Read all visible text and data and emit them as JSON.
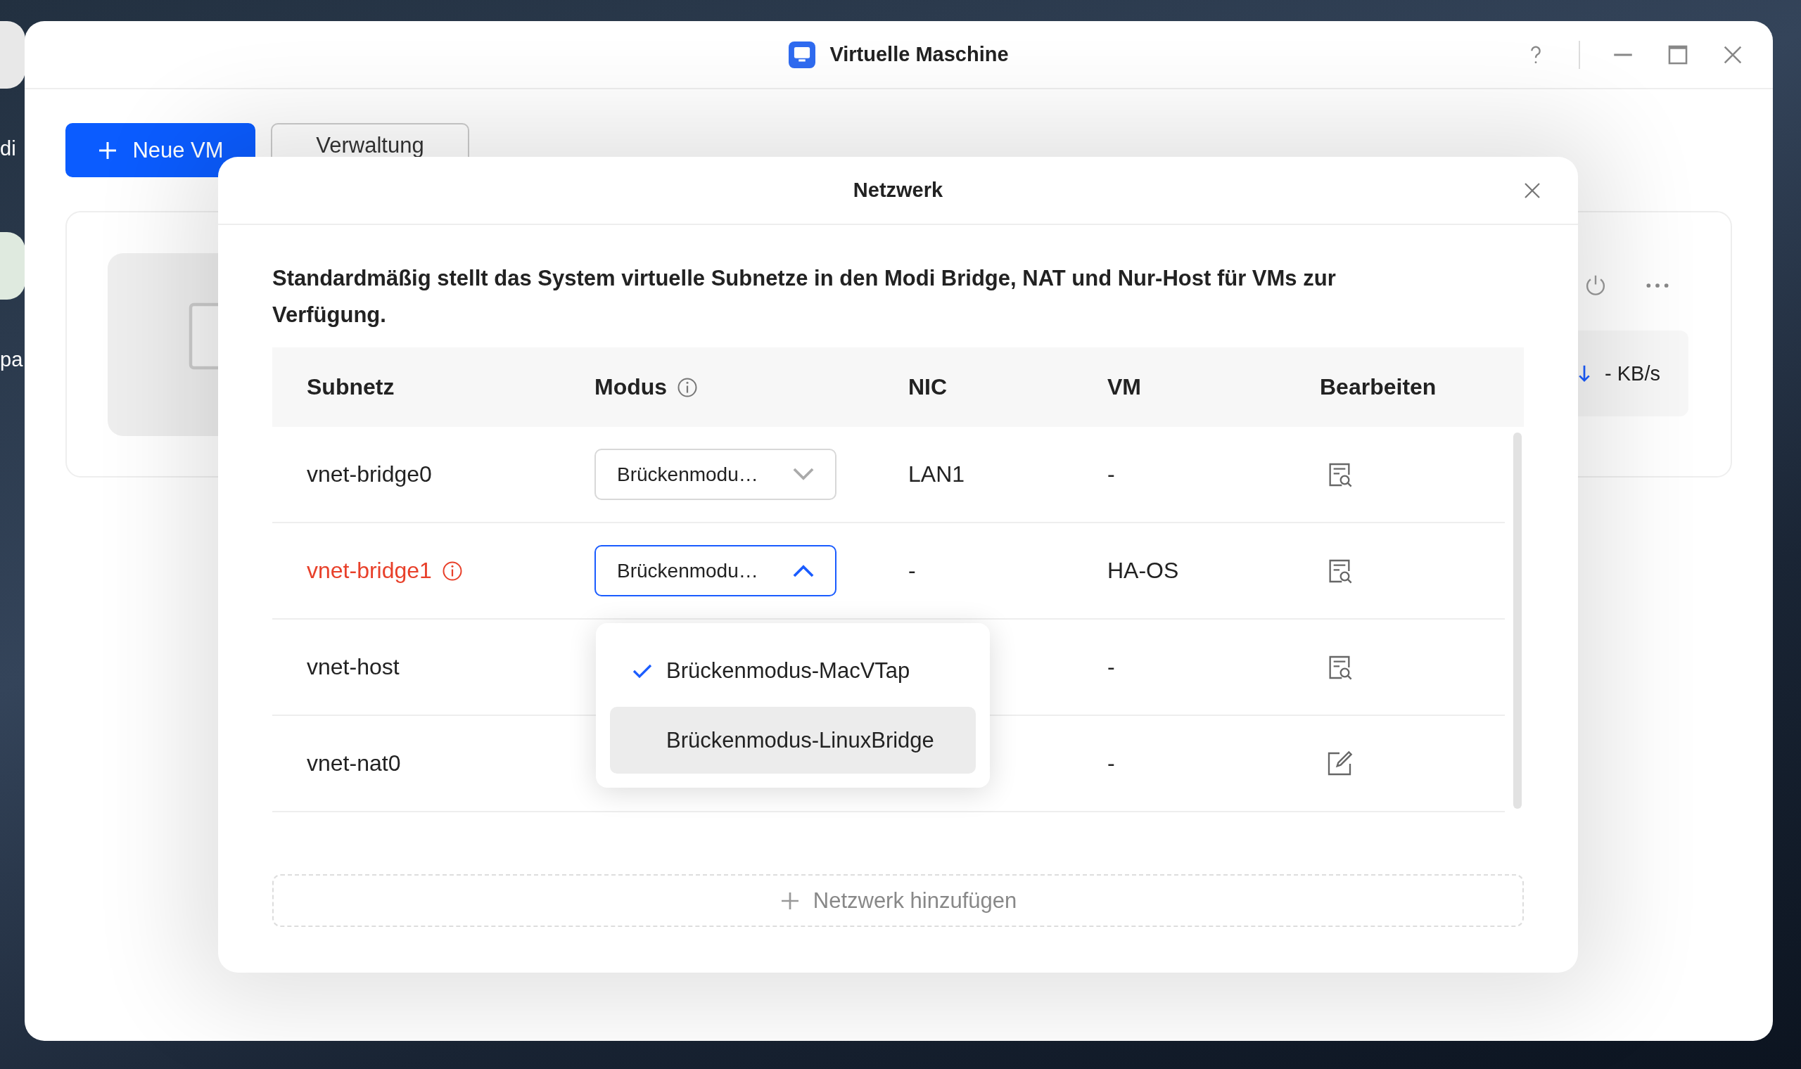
{
  "desktop": {
    "icon_labels": [
      "di",
      "pa"
    ]
  },
  "window": {
    "title": "Virtuelle Maschine"
  },
  "toolbar": {
    "buttons": [
      {
        "label": "Neue VM",
        "kind": "primary"
      },
      {
        "label": "Verwaltung",
        "kind": "secondary"
      }
    ]
  },
  "vm_card": {
    "speed": "- KB/s"
  },
  "dialog": {
    "title": "Netzwerk",
    "description": "Standardmäßig stellt das System virtuelle Subnetze in den Modi Bridge, NAT und Nur-Host für VMs zur Verfügung.",
    "columns": [
      {
        "label": "Subnetz",
        "kind": "plain"
      },
      {
        "label": "Modus",
        "kind": "info"
      },
      {
        "label": "NIC",
        "kind": "plain"
      },
      {
        "label": "VM",
        "kind": "plain"
      },
      {
        "label": "Bearbeiten",
        "kind": "plain"
      }
    ],
    "rows": [
      {
        "subnet": "vnet-bridge0",
        "warning": false,
        "mode": "Brückenmodu…",
        "open": false,
        "nic": "LAN1",
        "vm": "-",
        "kind": "view"
      },
      {
        "subnet": "vnet-bridge1",
        "warning": true,
        "mode": "Brückenmodu…",
        "open": true,
        "nic": "-",
        "vm": "HA-OS",
        "kind": "view"
      },
      {
        "subnet": "vnet-host",
        "warning": false,
        "vm": "-",
        "kind": "view"
      },
      {
        "subnet": "vnet-nat0",
        "warning": false,
        "vm": "-",
        "kind": "edit"
      }
    ],
    "mode_menu": [
      {
        "label": "Brückenmodus-MacVTap",
        "selected": true,
        "hovered": false
      },
      {
        "label": "Brückenmodus-LinuxBridge",
        "selected": false,
        "hovered": true
      }
    ],
    "add_button": "Netzwerk hinzufügen"
  }
}
